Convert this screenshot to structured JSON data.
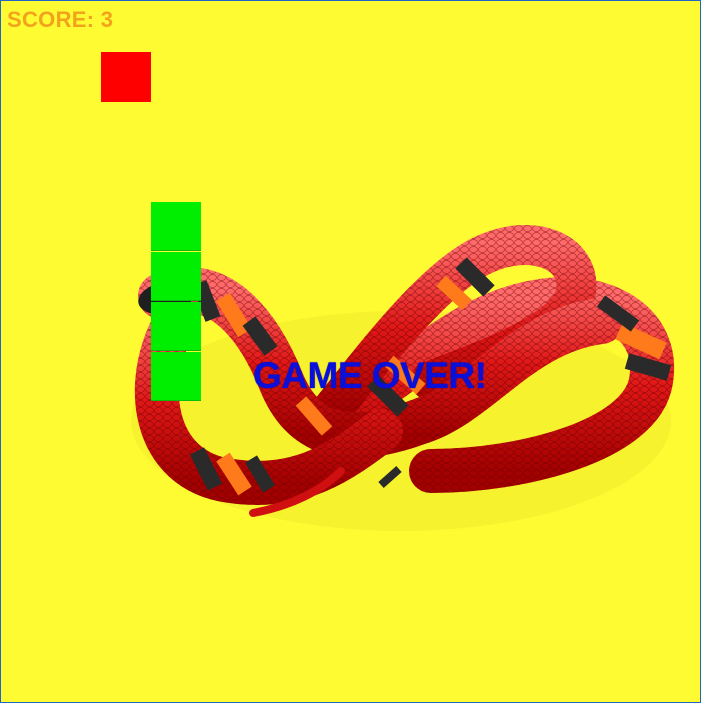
{
  "hud": {
    "score_text": "SCORE: 3"
  },
  "board": {
    "background_color": "#fffb33",
    "food_color": "#ff0000",
    "snake_color": "#00ee00",
    "snake_length": 4
  },
  "overlay": {
    "message": "GAME OVER!",
    "message_color": "#0b10d8"
  },
  "background_image": {
    "icon": "coral-snake-illustration"
  }
}
